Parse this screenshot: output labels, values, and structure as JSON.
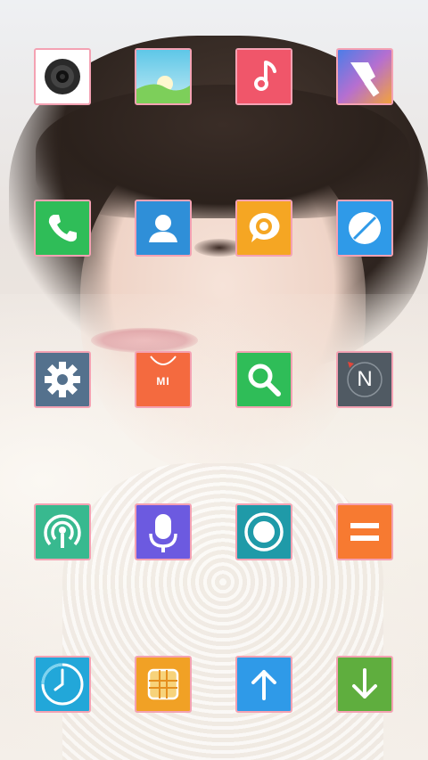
{
  "screen": {
    "type": "home-screen",
    "wallpaper": "portrait-photo"
  },
  "apps": [
    {
      "icon": "camera-icon",
      "color": "#ffffff"
    },
    {
      "icon": "gallery-icon",
      "color": "#7dcf5a"
    },
    {
      "icon": "music-icon",
      "color": "#f0566a"
    },
    {
      "icon": "themes-icon",
      "color": "#6a66d8"
    },
    {
      "icon": "phone-icon",
      "color": "#2fbd58"
    },
    {
      "icon": "contacts-icon",
      "color": "#2f8fd8"
    },
    {
      "icon": "messaging-icon",
      "color": "#f5a623"
    },
    {
      "icon": "browser-icon",
      "color": "#2f9ae8"
    },
    {
      "icon": "settings-icon",
      "color": "#54718d"
    },
    {
      "icon": "mi-store-icon",
      "color": "#f46a3f",
      "label": "MI"
    },
    {
      "icon": "search-icon",
      "color": "#2fbd58"
    },
    {
      "icon": "compass-icon",
      "color": "#505a63",
      "label": "N"
    },
    {
      "icon": "wifi-hotspot-icon",
      "color": "#38b98f"
    },
    {
      "icon": "voice-recorder-icon",
      "color": "#6c5ae0"
    },
    {
      "icon": "screen-recorder-icon",
      "color": "#1f9aa8"
    },
    {
      "icon": "calculator-icon",
      "color": "#f77a31"
    },
    {
      "icon": "clock-icon",
      "color": "#22a7d9"
    },
    {
      "icon": "sim-toolkit-icon",
      "color": "#f1a125"
    },
    {
      "icon": "update-icon",
      "color": "#2f9ae8"
    },
    {
      "icon": "download-icon",
      "color": "#5fae3e"
    }
  ]
}
